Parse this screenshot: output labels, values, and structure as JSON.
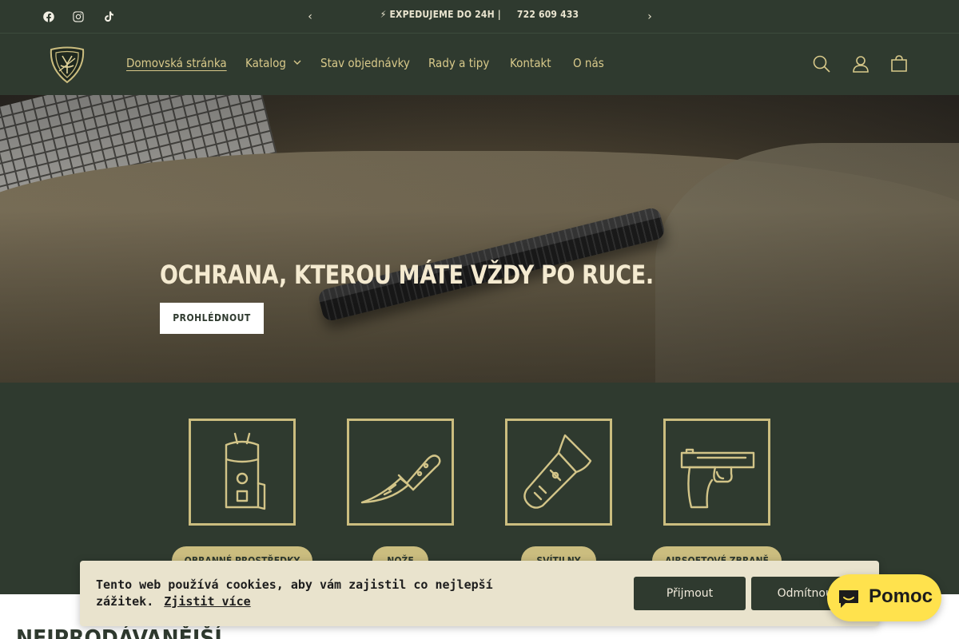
{
  "announcement": {
    "text": "⚡ EXPEDUJEME DO 24H |",
    "phone": "722 609 433",
    "prev_icon": "chevron-left-icon",
    "next_icon": "chevron-right-icon"
  },
  "social": [
    "facebook-icon",
    "instagram-icon",
    "tiktok-icon"
  ],
  "nav": {
    "home": "Domovská stránka",
    "catalog": "Katalog",
    "order_status": "Stav objednávky",
    "tips": "Rady a tipy",
    "contact": "Kontakt",
    "about": "O nás"
  },
  "header_icons": [
    "search-icon",
    "account-icon",
    "cart-icon"
  ],
  "hero": {
    "title": "OCHRANA, KTEROU MÁTE VŽDY PO RUCE.",
    "button": "PROHLÉDNOUT"
  },
  "categories": [
    {
      "label": "OBRANNÉ PROSTŘEDKY",
      "icon": "stun-gun-icon"
    },
    {
      "label": "NOŽE",
      "icon": "knife-icon"
    },
    {
      "label": "SVÍTILNY",
      "icon": "flashlight-icon"
    },
    {
      "label": "AIRSOFTOVÉ ZBRANĚ",
      "icon": "pistol-icon"
    }
  ],
  "section_title": "NEJPRODÁVANĚJŠÍ",
  "cookie": {
    "icon": "",
    "text": "Tento web používá cookies, aby vám zajistil co nejlepší zážitek.",
    "link": "Zjistit více",
    "accept": "Přijmout",
    "decline": "Odmítnout"
  },
  "chat": {
    "label": "Pomoc",
    "icon": "chat-bubble-icon"
  },
  "colors": {
    "brand_dark": "#2f3a2f",
    "accent_gold": "#cbbd7f",
    "chat_yellow": "#ffe24d"
  }
}
